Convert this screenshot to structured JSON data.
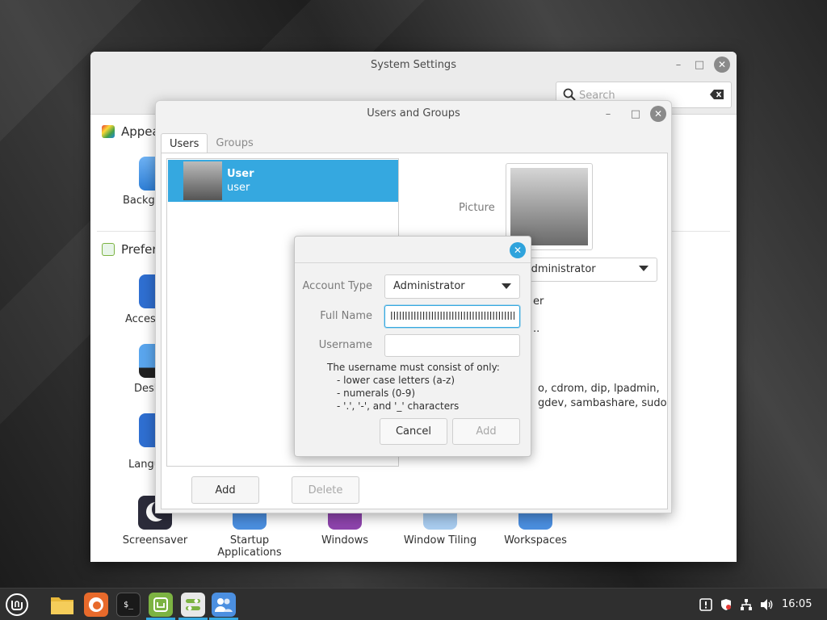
{
  "system_settings": {
    "title": "System Settings",
    "search_placeholder": "Search",
    "sections": [
      {
        "title": "Appearance"
      },
      {
        "title": "Preferences"
      }
    ],
    "tiles_left": [
      "Backgrounds",
      "Accessibility",
      "Desklets",
      "Languages"
    ],
    "tiles_bottom": [
      {
        "line1": "Screensaver",
        "line2": ""
      },
      {
        "line1": "Startup",
        "line2": "Applications"
      },
      {
        "line1": "Windows",
        "line2": ""
      },
      {
        "line1": "Window Tiling",
        "line2": ""
      },
      {
        "line1": "Workspaces",
        "line2": ""
      }
    ]
  },
  "users_and_groups": {
    "title": "Users and Groups",
    "tabs": [
      "Users",
      "Groups"
    ],
    "active_tab": "Users",
    "selected_user": {
      "name": "User",
      "username": "user"
    },
    "picture_label": "Picture",
    "account_type_value": "Administrator",
    "details_partial": {
      "line_a": "er",
      "line_b": "..",
      "groups_line1": "o, cdrom, dip, lpadmin,",
      "groups_line2": "gdev, sambashare, sudo"
    },
    "buttons": {
      "add": "Add",
      "delete": "Delete"
    }
  },
  "add_user_dialog": {
    "account_type_label": "Account Type",
    "account_type_value": "Administrator",
    "full_name_label": "Full Name",
    "full_name_value": "lllllllllllllllllllllllllllllllllllllllllllllllllllllll",
    "username_label": "Username",
    "username_value": "",
    "hint_title": "The username must consist of only:",
    "hint_lines": [
      "- lower case letters (a-z)",
      "- numerals (0-9)",
      "- '.', '-', and '_' characters"
    ],
    "cancel_label": "Cancel",
    "add_label": "Add"
  },
  "taskbar": {
    "clock": "16:05"
  },
  "colors": {
    "accent": "#35a8e0",
    "selection": "#35a8e0",
    "mint_green": "#7cb342"
  },
  "icons": {
    "menu": "linux-mint-logo-icon",
    "files": "folder-icon",
    "browser": "firefox-icon",
    "terminal": "terminal-icon",
    "software": "software-manager-icon",
    "settings": "system-settings-icon",
    "users": "users-icon"
  }
}
